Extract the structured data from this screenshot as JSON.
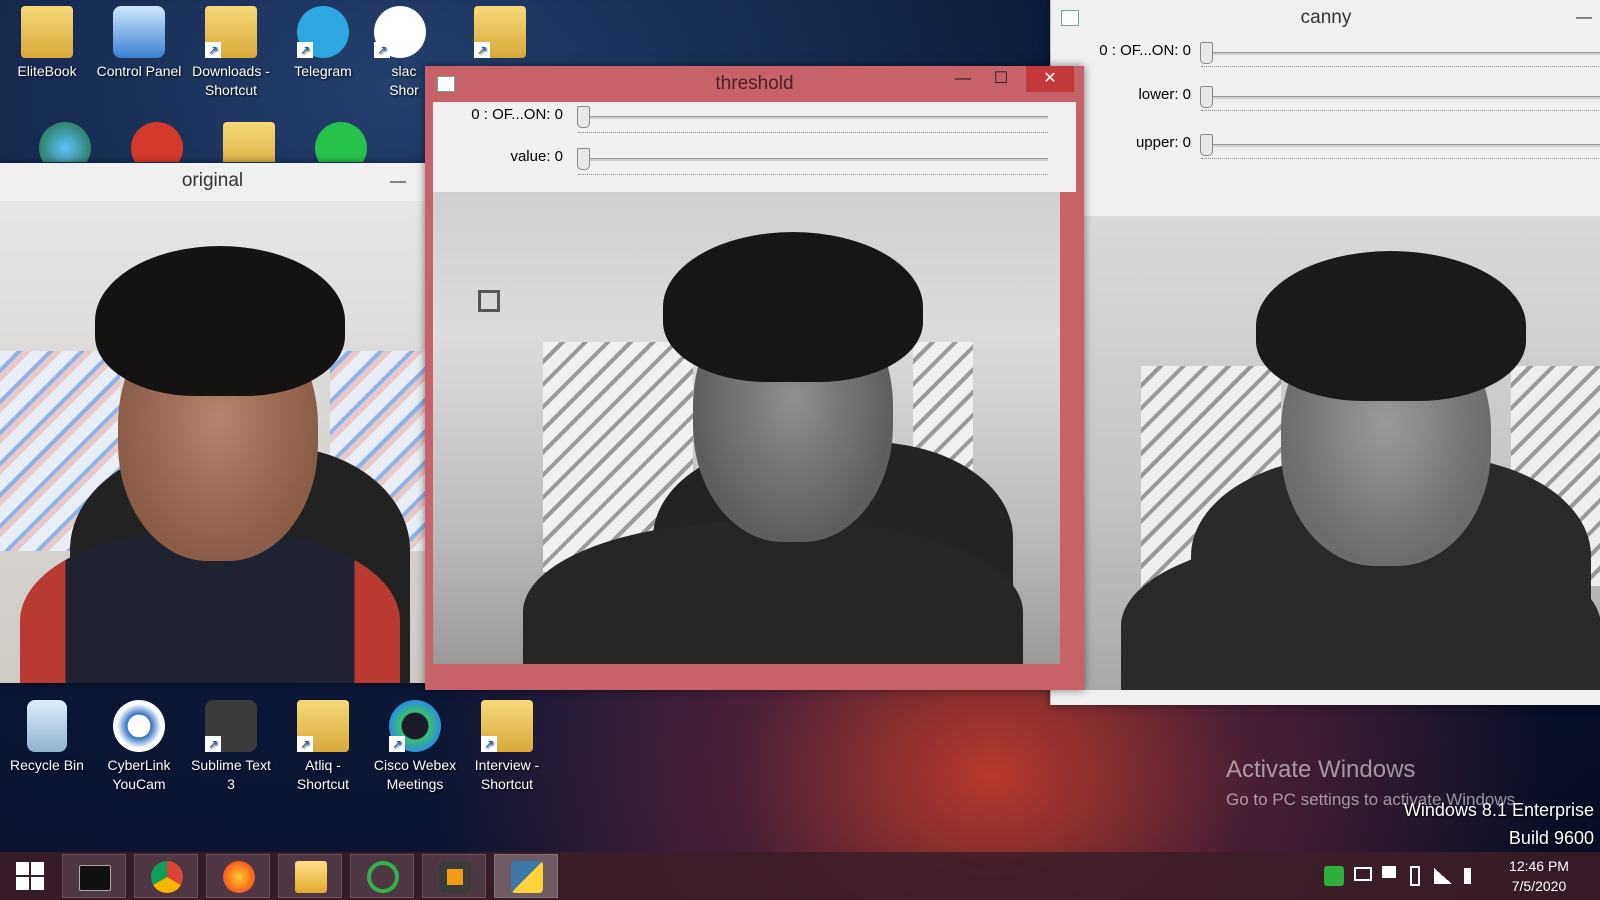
{
  "desktop": {
    "top_icons": [
      {
        "label": "EliteBook",
        "icon": "folder-user-icon"
      },
      {
        "label": "Control Panel",
        "icon": "control-panel-icon"
      },
      {
        "label": "Downloads - Shortcut",
        "icon": "downloads-folder-icon"
      },
      {
        "label": "Telegram",
        "icon": "telegram-icon"
      },
      {
        "label": "slac Shor",
        "icon": "slack-icon"
      }
    ],
    "bottom_icons": [
      {
        "label": "Recycle Bin",
        "icon": "recycle-bin-icon"
      },
      {
        "label": "CyberLink YouCam",
        "icon": "youcam-icon"
      },
      {
        "label": "Sublime Text 3",
        "icon": "sublime-text-icon"
      },
      {
        "label": "Atliq - Shortcut",
        "icon": "folder-icon"
      },
      {
        "label": "Cisco Webex Meetings",
        "icon": "webex-icon"
      },
      {
        "label": "Interview - Shortcut",
        "icon": "folder-icon"
      }
    ]
  },
  "windows": {
    "original": {
      "title": "original",
      "minimize": "—"
    },
    "threshold": {
      "title": "threshold",
      "minimize": "—",
      "maximize": "☐",
      "close": "✕",
      "trackbars": [
        {
          "label": "0 : OF...ON: 0",
          "value": 0
        },
        {
          "label": "value: 0",
          "value": 0
        }
      ]
    },
    "canny": {
      "title": "canny",
      "minimize": "—",
      "trackbars": [
        {
          "label": "0 : OF...ON: 0",
          "value": 0
        },
        {
          "label": "lower: 0",
          "value": 0
        },
        {
          "label": "upper: 0",
          "value": 0
        }
      ]
    }
  },
  "watermark": {
    "line1": "Activate Windows",
    "line2": "Go to PC settings to activate Windows.",
    "edition": "Windows 8.1 Enterprise",
    "build": "Build 9600"
  },
  "taskbar": {
    "start_icon": "windows-start-icon",
    "apps": [
      "cmd-icon",
      "chrome-icon",
      "firefox-icon",
      "file-explorer-icon",
      "refresh-app-icon",
      "sublime-text-icon",
      "python-icon"
    ],
    "time": "12:46 PM",
    "date": "7/5/2020",
    "tray_icons": [
      "q-app-icon",
      "network-display-icon",
      "flag-icon",
      "battery-icon",
      "signal-icon",
      "volume-icon"
    ]
  },
  "colors": {
    "threshold_border": "#c7626b",
    "window_bg": "#f0f0f0"
  }
}
